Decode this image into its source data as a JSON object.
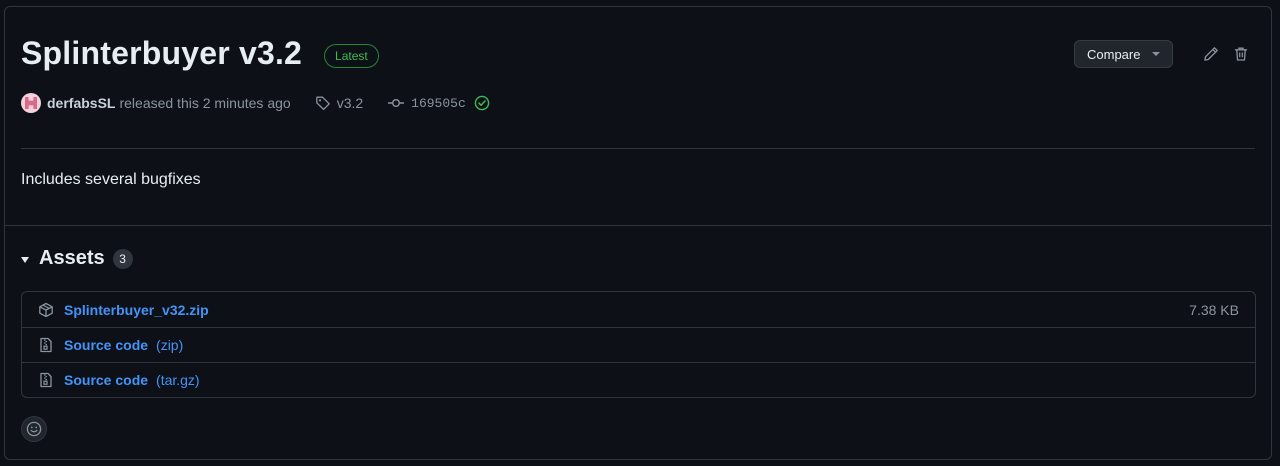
{
  "release": {
    "title": "Splinterbuyer v3.2",
    "badge": "Latest",
    "author": "derfabsSL",
    "released_text": "released this 2 minutes ago",
    "tag": "v3.2",
    "commit": "169505c",
    "description": "Includes several bugfixes"
  },
  "actions": {
    "compare_label": "Compare"
  },
  "assets": {
    "title": "Assets",
    "count": "3",
    "items": [
      {
        "name": "Splinterbuyer_v32.zip",
        "ext": "",
        "size": "7.38 KB",
        "icon": "package-icon"
      },
      {
        "name": "Source code",
        "ext": "(zip)",
        "size": "",
        "icon": "file-zip-icon"
      },
      {
        "name": "Source code",
        "ext": "(tar.gz)",
        "size": "",
        "icon": "file-zip-icon"
      }
    ]
  },
  "colors": {
    "background": "#0d1117",
    "border": "#30363d",
    "link": "#4493f8",
    "success": "#3fb950",
    "muted": "#8b949e"
  }
}
